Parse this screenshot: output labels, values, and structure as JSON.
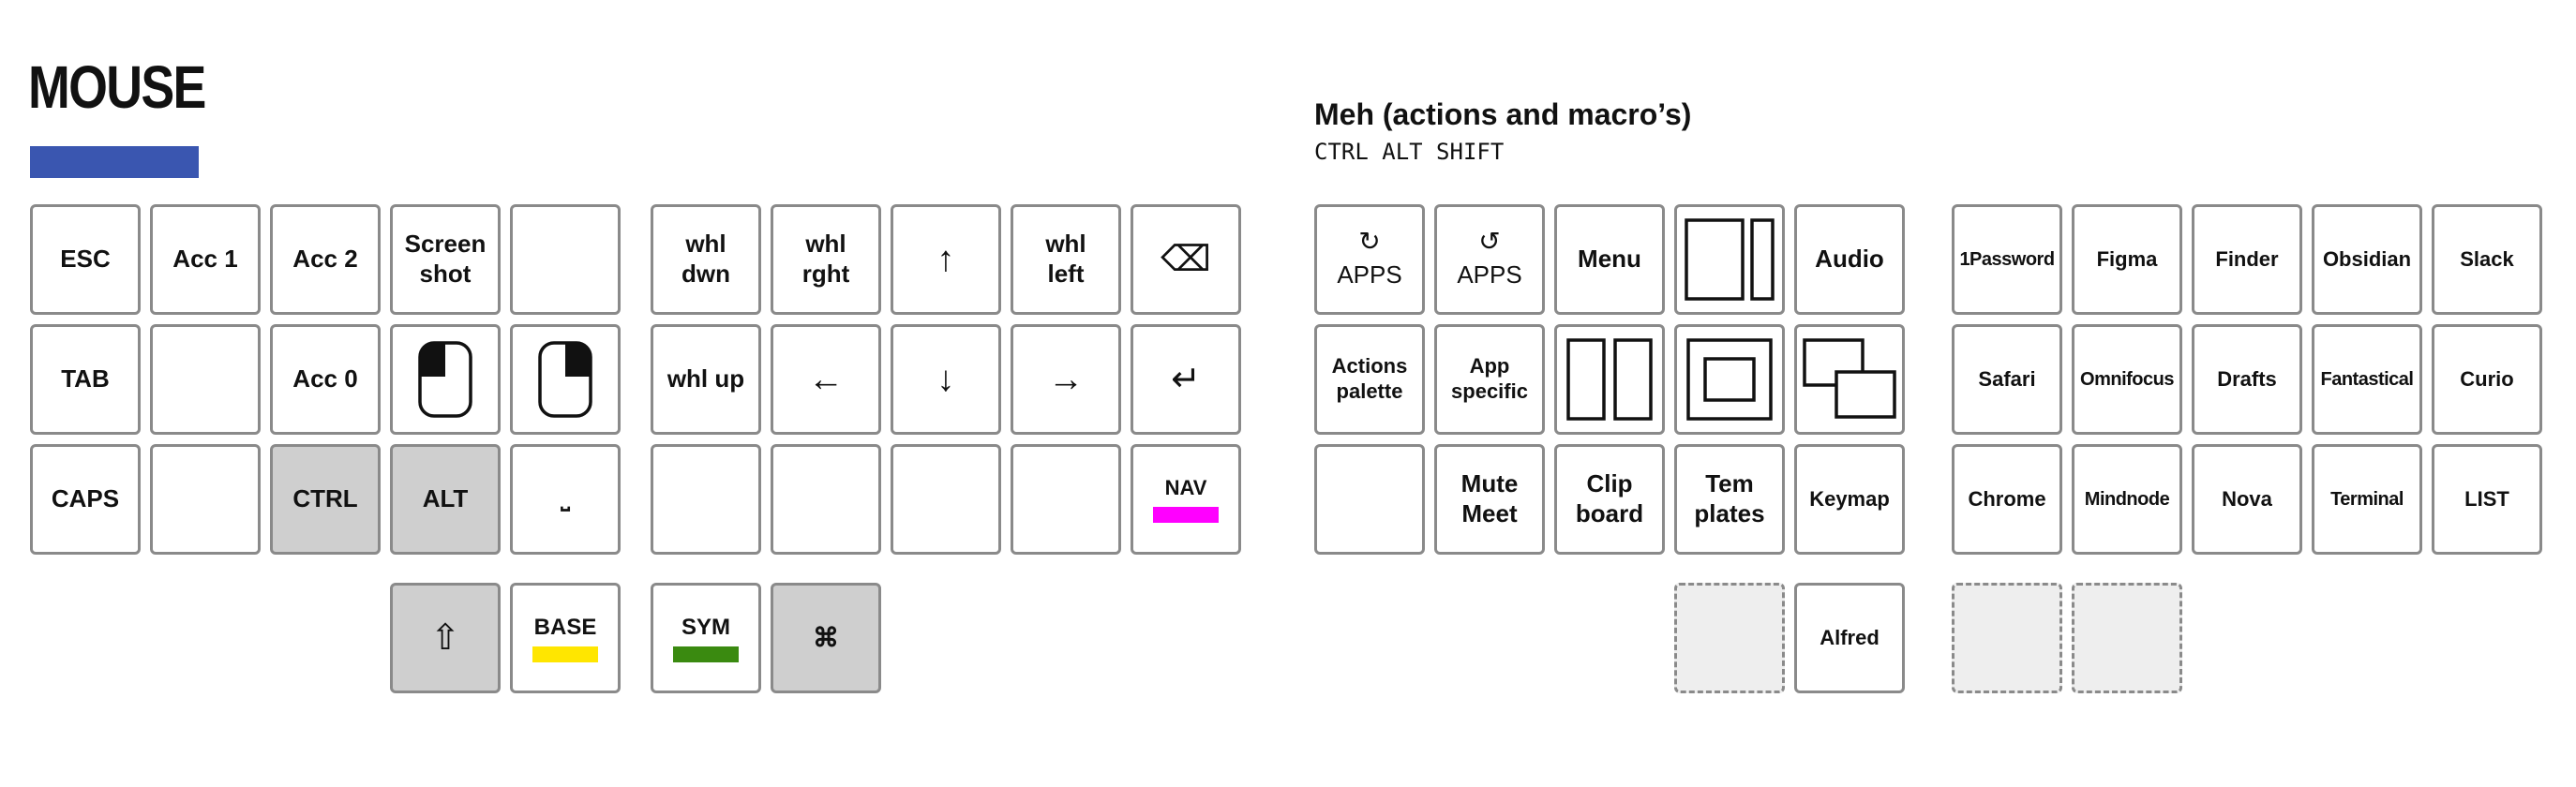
{
  "mouse_layer": {
    "title": "MOUSE",
    "color": "#3a56b0",
    "keys": {
      "esc": "ESC",
      "acc1": "Acc 1",
      "acc2": "Acc 2",
      "screenshot": "Screen\nshot",
      "tab": "TAB",
      "acc0": "Acc 0",
      "caps": "CAPS",
      "ctrl": "CTRL",
      "alt": "ALT",
      "space": "⎵",
      "whl_dwn": "whl\ndwn",
      "whl_rght": "whl\nrght",
      "up_arrow": "↑",
      "whl_left": "whl\nleft",
      "backspace": "⌫",
      "whl_up": "whl up",
      "left_arrow": "←",
      "down_arrow": "↓",
      "right_arrow": "→",
      "enter": "↵",
      "nav": "NAV",
      "shift": "⇧",
      "base": "BASE",
      "sym": "SYM",
      "cmd": "⌘"
    },
    "layer_colors": {
      "nav": "#ff00ff",
      "base": "#ffe600",
      "sym": "#3a8a10"
    },
    "mouse_icons": [
      "mouse-left-click-icon",
      "mouse-right-click-icon"
    ]
  },
  "meh_layer": {
    "title": "Meh (actions and macro’s)",
    "subtitle": "CTRL ALT SHIFT",
    "keys": {
      "apps_cw_icon": "↻",
      "apps_cw": "APPS",
      "apps_ccw_icon": "↺",
      "apps_ccw": "APPS",
      "menu": "Menu",
      "audio": "Audio",
      "actions_palette": "Actions\npalette",
      "app_specific": "App\nspecific",
      "mute_meet": "Mute\nMeet",
      "clipboard": "Clip\nboard",
      "templates": "Tem\nplates",
      "keymap": "Keymap",
      "alfred": "Alfred",
      "onepassword": "1Password",
      "figma": "Figma",
      "finder": "Finder",
      "obsidian": "Obsidian",
      "slack": "Slack",
      "safari": "Safari",
      "omnifocus": "Omnifocus",
      "drafts": "Drafts",
      "fantastical": "Fantastical",
      "curio": "Curio",
      "chrome": "Chrome",
      "mindnode": "Mindnode",
      "nova": "Nova",
      "terminal": "Terminal",
      "list": "LIST"
    },
    "window_icons": [
      "window-split-two-thirds-icon",
      "window-split-halves-icon",
      "window-center-icon",
      "window-cascade-icon"
    ]
  }
}
